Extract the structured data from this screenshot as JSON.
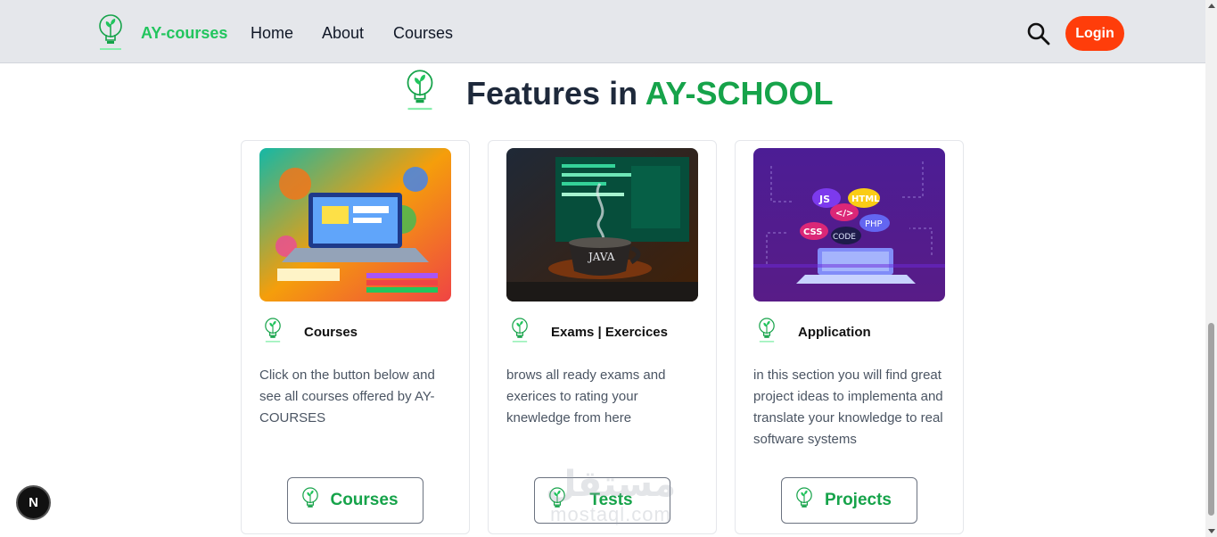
{
  "navbar": {
    "brand": "AY-courses",
    "links": [
      "Home",
      "About",
      "Courses"
    ],
    "login_label": "Login"
  },
  "heading": {
    "prefix": "Features in ",
    "accent": "AY-SCHOOL"
  },
  "cards": [
    {
      "title": "Courses",
      "text": "Click on the button below and see all courses offered by AY-COURSES",
      "button_label": "Courses",
      "image": "laptop-education-illustration"
    },
    {
      "title": "Exams | Exercices",
      "text": "brows all ready exams and exerices to rating your knewledge from here",
      "button_label": "Tests",
      "image": "java-coffee-illustration"
    },
    {
      "title": "Application",
      "text": "in this section you will find great project ideas to implementa and translate your knowledge to real software systems",
      "button_label": "Projects",
      "image": "code-laptop-illustration"
    }
  ],
  "floating_button": "N",
  "watermark": {
    "arabic": "مستقل",
    "latin": "mostaql.com"
  },
  "colors": {
    "brand_green": "#22c55e",
    "accent_green": "#16a34a",
    "login_orange": "#ff3d0a",
    "navbar_bg": "#e5e7eb"
  }
}
